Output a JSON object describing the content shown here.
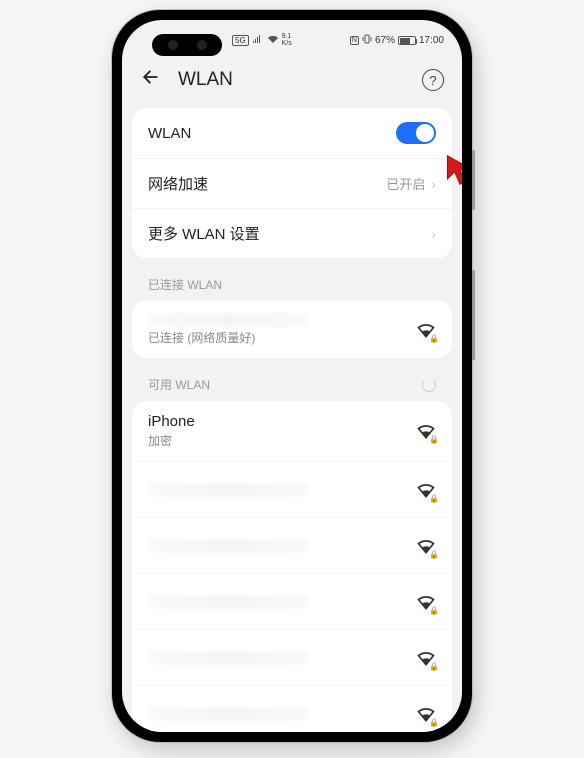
{
  "status_bar": {
    "net_speed": "9.1\nK/s",
    "battery_pct": "67%",
    "time": "17:00",
    "sg_label": "5G"
  },
  "header": {
    "title": "WLAN"
  },
  "main_card": {
    "wlan_label": "WLAN",
    "wlan_on": true,
    "accel_label": "网络加速",
    "accel_value": "已开启",
    "more_label": "更多 WLAN 设置"
  },
  "connected_section": {
    "header": "已连接 WLAN",
    "network": {
      "name": "",
      "sub": "已连接 (网络质量好)"
    }
  },
  "available_section": {
    "header": "可用 WLAN",
    "networks": [
      {
        "name": "iPhone",
        "sub": "加密",
        "locked": true
      },
      {
        "name": "",
        "sub": "",
        "locked": true
      },
      {
        "name": "",
        "sub": "",
        "locked": true
      },
      {
        "name": "",
        "sub": "",
        "locked": true
      },
      {
        "name": "",
        "sub": "",
        "locked": true
      },
      {
        "name": "",
        "sub": "",
        "locked": true
      }
    ]
  }
}
